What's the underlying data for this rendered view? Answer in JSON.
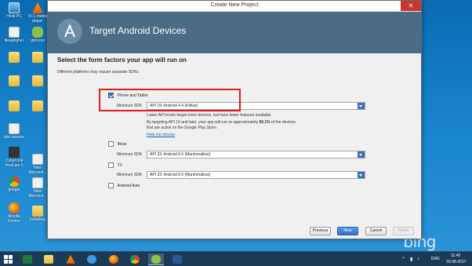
{
  "window": {
    "title": "Create New Project",
    "close_glyph": "✕",
    "header_title": "Target Android Devices",
    "logo_icon": "android-studio-icon"
  },
  "form": {
    "heading": "Select the form factors your app will run on",
    "subheading": "Different platforms may require separate SDKs",
    "minimum_sdk_label": "Minimum SDK",
    "phone": {
      "label": "Phone and Tablet",
      "checked": true,
      "min_sdk": "API 19: Android 4.4 (KitKat)",
      "info_line1": "Lower API levels target more devices, but have fewer features available.",
      "info_line2_a": "By targeting API 19 and later, your app will run on approximately ",
      "info_line2_b": "90.1%",
      "info_line2_c": " of the devices",
      "info_line3": "that are active on the Google Play Store.",
      "help_link": "Help me choose"
    },
    "wear": {
      "label": "Wear",
      "checked": false,
      "min_sdk": "API 23: Android 6.0 (Marshmallow)"
    },
    "tv": {
      "label": "TV",
      "checked": false,
      "min_sdk": "API 23: Android 6.0 (Marshmallow)"
    },
    "auto": {
      "label": "Android Auto",
      "checked": false
    }
  },
  "buttons": {
    "previous": "Previous",
    "next": "Next",
    "cancel": "Cancel",
    "finish": "Finish"
  },
  "desktop": {
    "icons": [
      {
        "label": "Hindi PC",
        "icon": "pc-icon"
      },
      {
        "label": "VLC media player",
        "icon": "vlc-icon"
      },
      {
        "label": "fileaghgher",
        "icon": "file-icon"
      },
      {
        "label": "gbhcool",
        "icon": "android-icon"
      },
      {
        "label": "",
        "icon": "folder-icon"
      },
      {
        "label": "",
        "icon": "folder-icon"
      },
      {
        "label": "",
        "icon": "folder-icon"
      },
      {
        "label": "",
        "icon": "folder-icon"
      },
      {
        "label": "",
        "icon": "folder-icon"
      },
      {
        "label": "",
        "icon": "folder-icon"
      },
      {
        "label": "",
        "icon": "folder-icon"
      },
      {
        "label": "",
        "icon": "folder-icon"
      },
      {
        "label": "abu resume",
        "icon": "file-icon"
      },
      {
        "label": "CyberLink YouCam 5",
        "icon": "cyberlink-icon"
      },
      {
        "label": "New Microsof...",
        "icon": "file-icon"
      },
      {
        "label": "google",
        "icon": "chrome-icon"
      },
      {
        "label": "New Microsof...",
        "icon": "file-icon"
      },
      {
        "label": "Mozilla Firefox",
        "icon": "firefox-icon"
      },
      {
        "label": "kollathey",
        "icon": "folder-icon"
      }
    ],
    "wallpaper_text": "bing"
  },
  "taskbar": {
    "apps": [
      {
        "icon": "excel-icon"
      },
      {
        "icon": "file-explorer-icon"
      },
      {
        "icon": "vlc-icon"
      },
      {
        "icon": "internet-explorer-icon"
      },
      {
        "icon": "firefox-icon"
      },
      {
        "icon": "chrome-icon"
      },
      {
        "icon": "android-studio-icon"
      },
      {
        "icon": "word-icon"
      }
    ],
    "language": "ENG",
    "time": "11:40",
    "date": "20-08-2017"
  },
  "colors": {
    "header_bg": "#4a6c85",
    "accent_blue": "#2f6fc9",
    "highlight_red": "#e01c1c",
    "taskbar_bg": "#1b3a56"
  }
}
